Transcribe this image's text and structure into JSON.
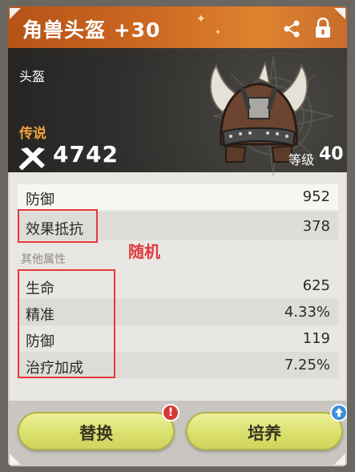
{
  "item": {
    "title": "角兽头盔 +30",
    "slot": "头盔",
    "rarity": "传说",
    "power": "4742",
    "level_label": "等级",
    "level_value": "40"
  },
  "main_stat": {
    "label": "防御",
    "value": "952"
  },
  "random_stat": {
    "label": "效果抵抗",
    "value": "378"
  },
  "annotation": "随机",
  "other_header": "其他属性",
  "sub_stats": [
    {
      "label": "生命",
      "value": "625"
    },
    {
      "label": "精准",
      "value": "4.33%"
    },
    {
      "label": "防御",
      "value": "119"
    },
    {
      "label": "治疗加成",
      "value": "7.25%"
    }
  ],
  "buttons": {
    "replace": "替换",
    "train": "培养"
  },
  "badges": {
    "replace_alert": "!"
  },
  "colors": {
    "header_orange": "#cf6a22",
    "rarity_gold": "#f2a23b",
    "annotation_red": "#e2393d",
    "button_yellow": "#dbe06e"
  },
  "icons": [
    "share-icon",
    "lock-icon",
    "power-icon",
    "helmet-icon",
    "alert-icon",
    "upgrade-arrow-icon"
  ]
}
